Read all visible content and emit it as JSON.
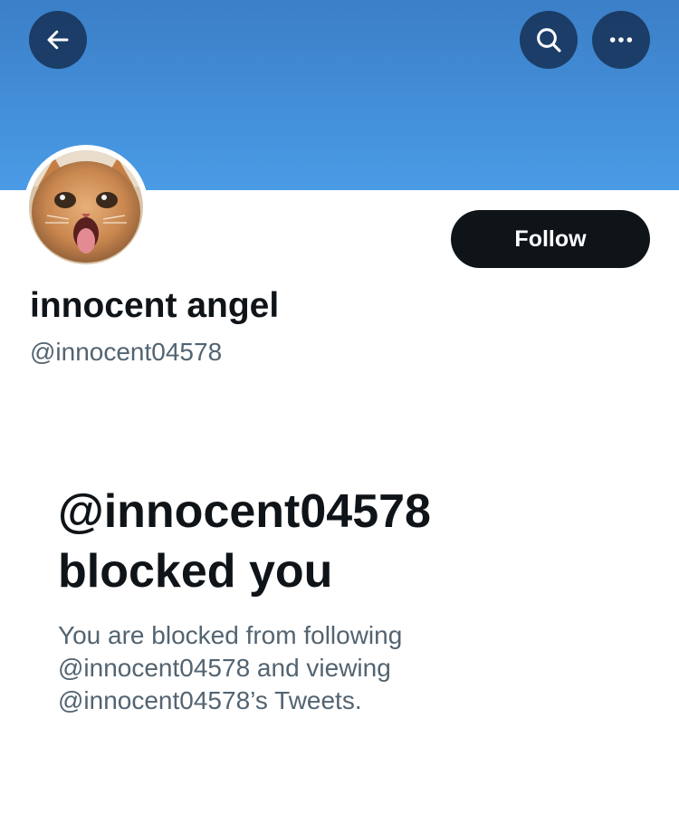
{
  "header": {
    "banner_color": "#4a9be6",
    "back_icon": "arrow-left-icon",
    "search_icon": "search-icon",
    "more_icon": "more-horizontal-icon"
  },
  "profile": {
    "avatar": "cat-avatar",
    "display_name": "innocent angel",
    "handle": "@innocent04578",
    "follow_label": "Follow"
  },
  "blocked": {
    "title_line1": "@innocent04578",
    "title_line2": "blocked you",
    "message_line1": "You are blocked from following",
    "message_line2": "@innocent04578 and viewing",
    "message_line3": "@innocent04578’s Tweets."
  },
  "colors": {
    "text_primary": "#0f1419",
    "text_secondary": "#536471",
    "button_dark": "#0f1419"
  }
}
